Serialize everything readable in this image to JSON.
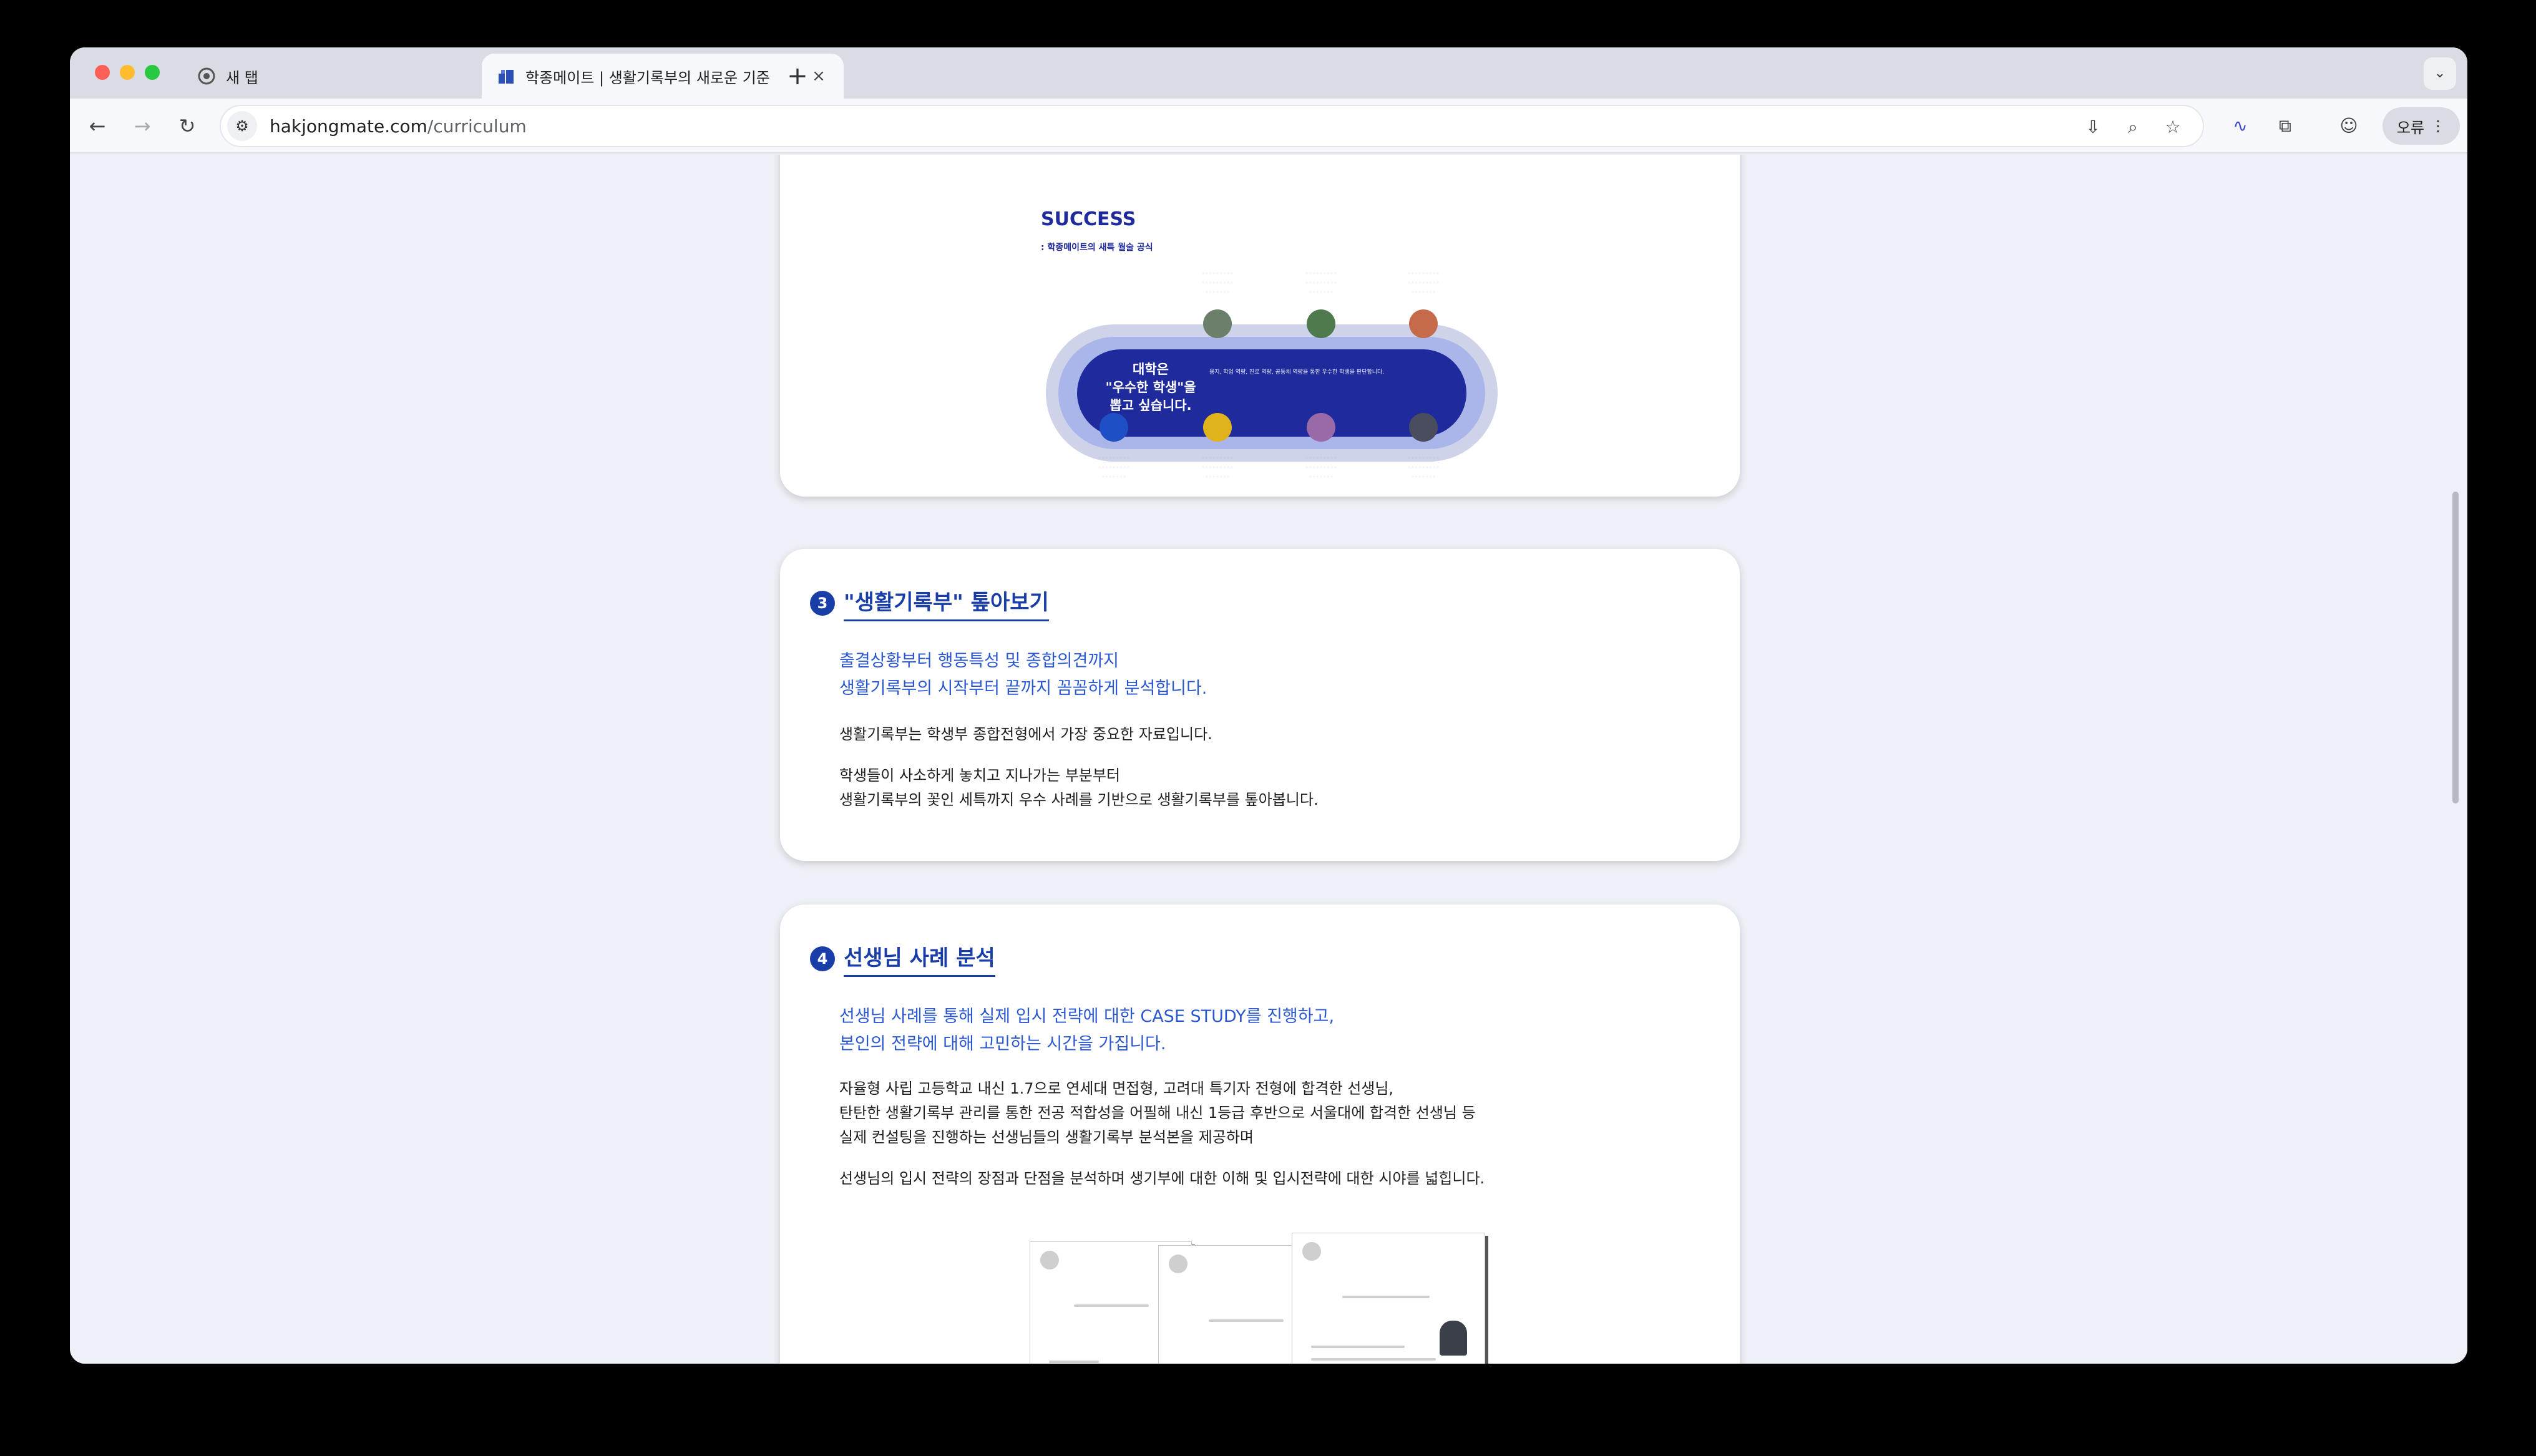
{
  "browser": {
    "tabs": [
      {
        "title": "새 탭",
        "favicon": "chrome-icon",
        "active": false
      },
      {
        "title": "학종메이트 | 생활기록부의 새로운 기준",
        "favicon": "hakjongmate-icon",
        "active": true
      }
    ],
    "new_tab_symbol": "+",
    "tab_menu_symbol": "⌄",
    "url_host": "hakjongmate.com",
    "url_path": "/curriculum",
    "profile_label": "오류"
  },
  "section2": {
    "diagram": {
      "heading": "SUCCESS",
      "subheading": ": 학종메이트의 새특 월술 공식",
      "core_title": "대학은\n\"우수한 학생\"을\n뽑고 싶습니다.",
      "core_lines": "용지, 학업 역량, 진로 역량, 공동체 역량을 통한 우수한 학생을 판단합니다."
    }
  },
  "section3": {
    "number": "3",
    "title": "\"생활기록부\" 톺아보기",
    "lead_1": "출결상황부터 행동특성 및 종합의견까지",
    "lead_2": "생활기록부의 시작부터 끝까지 꼼꼼하게 분석합니다.",
    "para_1": "생활기록부는 학생부 종합전형에서 가장 중요한 자료입니다.",
    "para_2_1": "학생들이 사소하게 놓치고 지나가는 부분부터",
    "para_2_2": "생활기록부의 꽃인 세특까지 우수 사례를 기반으로 생활기록부를 톺아봅니다."
  },
  "section4": {
    "number": "4",
    "title": "선생님 사례 분석",
    "lead_1": "선생님 사례를 통해 실제 입시 전략에 대한 CASE STUDY를 진행하고,",
    "lead_2": "본인의 전략에 대해 고민하는 시간을 가집니다.",
    "para_1_1": "자율형 사립 고등학교 내신 1.7으로 연세대 면접형, 고려대 특기자 전형에 합격한 선생님,",
    "para_1_2": "탄탄한 생활기록부 관리를 통한 전공 적합성을 어필해 내신 1등급 후반으로 서울대에 합격한 선생님 등",
    "para_1_3": "실제 컨설팅을 진행하는 선생님들의 생활기록부 분석본을 제공하며",
    "para_2": "선생님의 입시 전략의 장점과 단점을 분석하며 생기부에 대한 이해 및 입시전략에 대한 시야를 넓힙니다."
  },
  "colors": {
    "accent": "#1a3ea8",
    "lead_text": "#2b58d0",
    "diagram_core": "#1f2a9c"
  }
}
